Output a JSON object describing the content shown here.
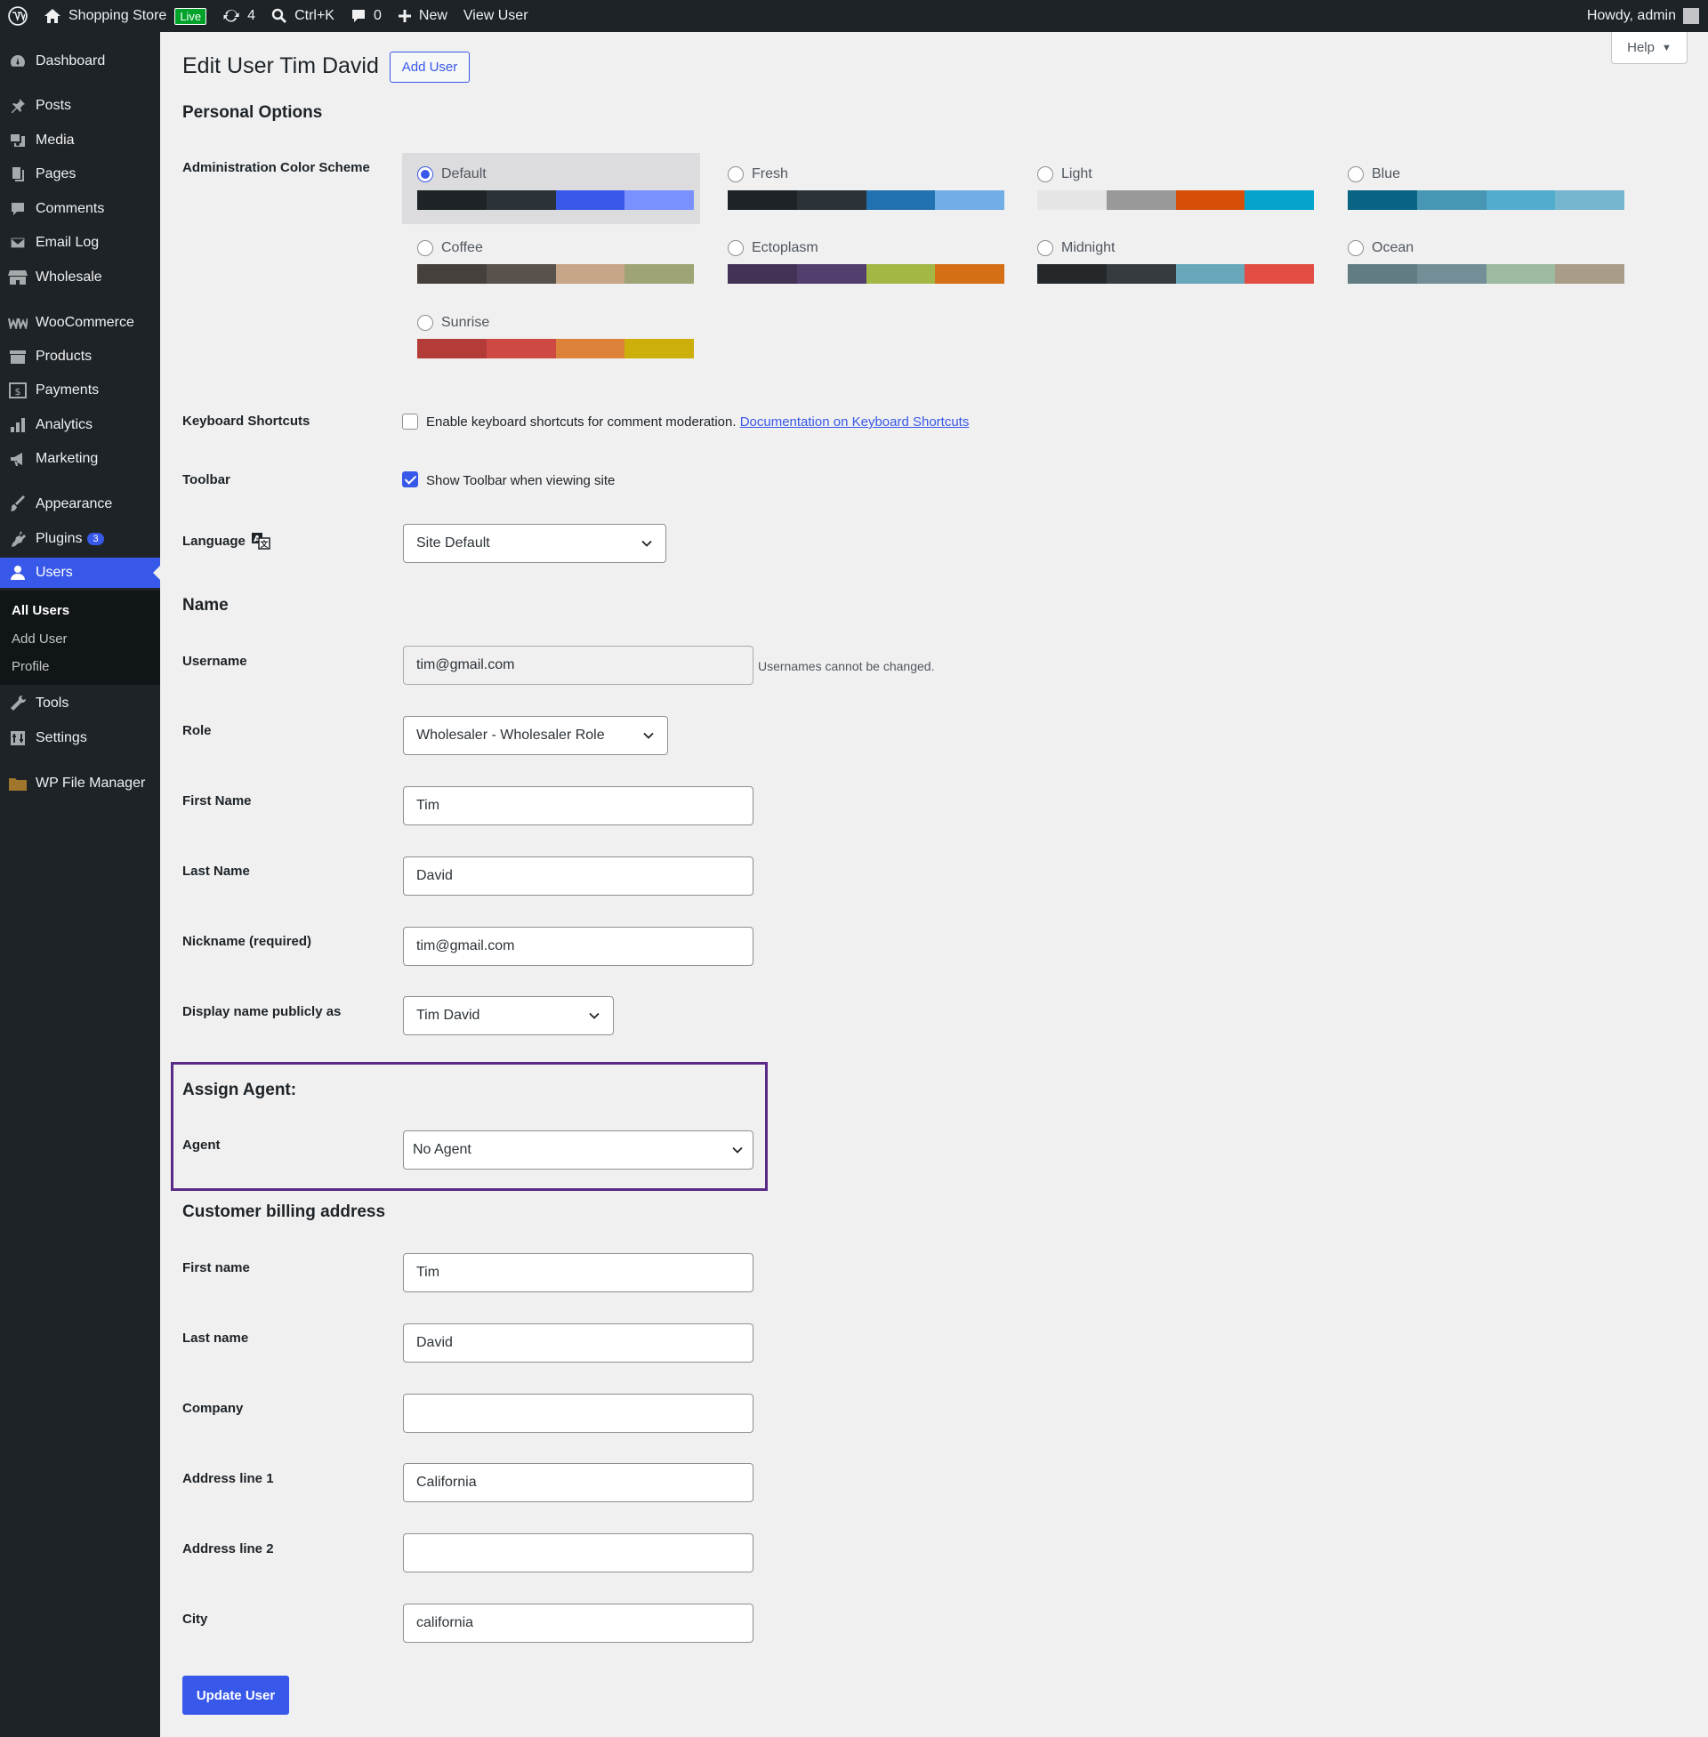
{
  "adminbar": {
    "site_name": "Shopping Store",
    "live_badge": "Live",
    "updates_count": "4",
    "search_shortcut": "Ctrl+K",
    "comments_count": "0",
    "new_label": "New",
    "view_user": "View User",
    "howdy": "Howdy, admin"
  },
  "sidebar": {
    "items": [
      {
        "label": "Dashboard",
        "icon": "dashboard-icon"
      },
      {
        "label": "Posts",
        "icon": "pin-icon"
      },
      {
        "label": "Media",
        "icon": "media-icon"
      },
      {
        "label": "Pages",
        "icon": "pages-icon"
      },
      {
        "label": "Comments",
        "icon": "comment-icon"
      },
      {
        "label": "Email Log",
        "icon": "email-icon"
      },
      {
        "label": "Wholesale",
        "icon": "store-icon"
      },
      {
        "label": "WooCommerce",
        "icon": "woo-icon"
      },
      {
        "label": "Products",
        "icon": "archive-icon"
      },
      {
        "label": "Payments",
        "icon": "payment-icon"
      },
      {
        "label": "Analytics",
        "icon": "chart-icon"
      },
      {
        "label": "Marketing",
        "icon": "megaphone-icon"
      },
      {
        "label": "Appearance",
        "icon": "brush-icon"
      },
      {
        "label": "Plugins",
        "icon": "plugin-icon",
        "badge": "3"
      },
      {
        "label": "Users",
        "icon": "users-icon"
      },
      {
        "label": "Tools",
        "icon": "wrench-icon"
      },
      {
        "label": "Settings",
        "icon": "settings-icon"
      },
      {
        "label": "WP File Manager",
        "icon": "folder-icon"
      }
    ],
    "submenu": [
      "All Users",
      "Add User",
      "Profile"
    ]
  },
  "help_label": "Help",
  "page": {
    "title": "Edit User Tim David",
    "add_new": "Add User"
  },
  "personal_options": {
    "heading": "Personal Options",
    "color_scheme_label": "Administration Color Scheme",
    "schemes": [
      {
        "name": "Default",
        "colors": [
          "#1d2327",
          "#2c3338",
          "#3858e9",
          "#7b90ff"
        ],
        "selected": true
      },
      {
        "name": "Fresh",
        "colors": [
          "#1d2327",
          "#2c3338",
          "#2271b1",
          "#72aee6"
        ]
      },
      {
        "name": "Light",
        "colors": [
          "#e5e5e5",
          "#999999",
          "#d64e07",
          "#04a4cc"
        ]
      },
      {
        "name": "Blue",
        "colors": [
          "#096484",
          "#4796b3",
          "#52accc",
          "#74b6ce"
        ]
      },
      {
        "name": "Coffee",
        "colors": [
          "#46403c",
          "#59524c",
          "#c7a589",
          "#9ea476"
        ]
      },
      {
        "name": "Ectoplasm",
        "colors": [
          "#413256",
          "#523f6d",
          "#a3b745",
          "#d46f15"
        ]
      },
      {
        "name": "Midnight",
        "colors": [
          "#25282b",
          "#363b3f",
          "#69a8bb",
          "#e14d43"
        ]
      },
      {
        "name": "Ocean",
        "colors": [
          "#627c83",
          "#738e96",
          "#9ebaa0",
          "#aa9d88"
        ]
      },
      {
        "name": "Sunrise",
        "colors": [
          "#b43c38",
          "#cf4944",
          "#dd823b",
          "#ccaf0b"
        ]
      }
    ],
    "keyboard_label": "Keyboard Shortcuts",
    "keyboard_text": "Enable keyboard shortcuts for comment moderation.",
    "keyboard_link": "Documentation on Keyboard Shortcuts",
    "toolbar_label": "Toolbar",
    "toolbar_text": "Show Toolbar when viewing site",
    "language_label": "Language",
    "language_value": "Site Default"
  },
  "name_section": {
    "heading": "Name",
    "username_label": "Username",
    "username_value": "tim@gmail.com",
    "username_note": "Usernames cannot be changed.",
    "role_label": "Role",
    "role_value": "Wholesaler - Wholesaler Role",
    "first_name_label": "First Name",
    "first_name_value": "Tim",
    "last_name_label": "Last Name",
    "last_name_value": "David",
    "nickname_label": "Nickname (required)",
    "nickname_value": "tim@gmail.com",
    "display_label": "Display name publicly as",
    "display_value": "Tim David"
  },
  "agent": {
    "heading": "Assign Agent:",
    "label": "Agent",
    "value": "No Agent"
  },
  "billing": {
    "heading": "Customer billing address",
    "first_name_label": "First name",
    "first_name_value": "Tim",
    "last_name_label": "Last name",
    "last_name_value": "David",
    "company_label": "Company",
    "company_value": "",
    "address1_label": "Address line 1",
    "address1_value": "California",
    "address2_label": "Address line 2",
    "address2_value": "",
    "city_label": "City",
    "city_value": "california"
  },
  "update_button": "Update User"
}
